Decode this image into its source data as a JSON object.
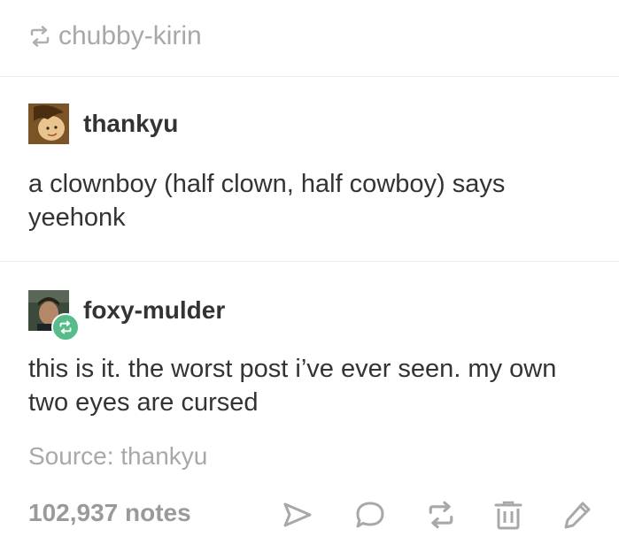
{
  "header": {
    "reblogged_from": "chubby-kirin"
  },
  "posts": [
    {
      "username": "thankyu",
      "text": "a clownboy (half clown, half cowboy) says yeehonk"
    },
    {
      "username": "foxy-mulder",
      "text": "this is it. the worst post i’ve ever seen. my own two eyes are cursed"
    }
  ],
  "source": {
    "label": "Source: thankyu"
  },
  "footer": {
    "notes": "102,937 notes"
  },
  "icons": {
    "reblog": "reblog-icon",
    "share": "share-icon",
    "reply": "reply-icon",
    "delete": "trash-icon",
    "edit": "pencil-icon"
  },
  "colors": {
    "text": "#333333",
    "muted": "#a8a8a8",
    "notes": "#9a9a9a",
    "reblog_badge": "#56bc8a",
    "divider": "#ececec"
  }
}
